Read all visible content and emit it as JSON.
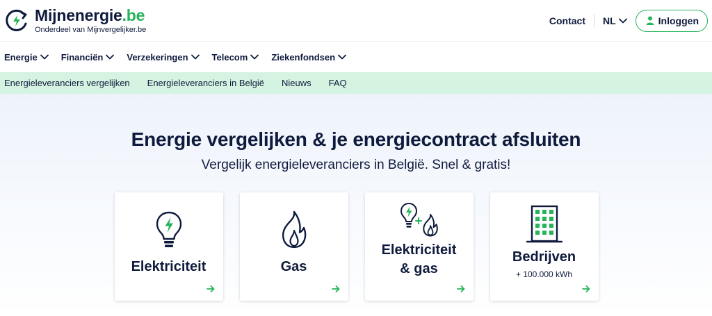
{
  "header": {
    "brand_name": "Mijnenergie",
    "brand_tld": ".be",
    "tagline": "Onderdeel van Mijnvergelijker.be",
    "contact_label": "Contact",
    "language": "NL",
    "login_label": "Inloggen"
  },
  "main_nav": [
    {
      "label": "Energie"
    },
    {
      "label": "Financiën"
    },
    {
      "label": "Verzekeringen"
    },
    {
      "label": "Telecom"
    },
    {
      "label": "Ziekenfondsen"
    }
  ],
  "sub_nav": [
    {
      "label": "Energieleveranciers vergelijken"
    },
    {
      "label": "Energieleveranciers in België"
    },
    {
      "label": "Nieuws"
    },
    {
      "label": "FAQ"
    }
  ],
  "hero": {
    "title": "Energie vergelijken & je energiecontract afsluiten",
    "subtitle": "Vergelijk energieleveranciers in België. Snel & gratis!"
  },
  "cards": [
    {
      "icon": "lightbulb-icon",
      "label": "Elektriciteit"
    },
    {
      "icon": "flame-icon",
      "label": "Gas"
    },
    {
      "icon": "lightbulb-flame-icon",
      "label_line1": "Elektriciteit",
      "label_line2": "& gas"
    },
    {
      "icon": "building-icon",
      "label": "Bedrijven",
      "sublabel": "+ 100.000 kWh"
    }
  ],
  "colors": {
    "navy": "#0f1b3d",
    "green": "#26b35a",
    "subnav_bg": "#d4f3e0"
  }
}
